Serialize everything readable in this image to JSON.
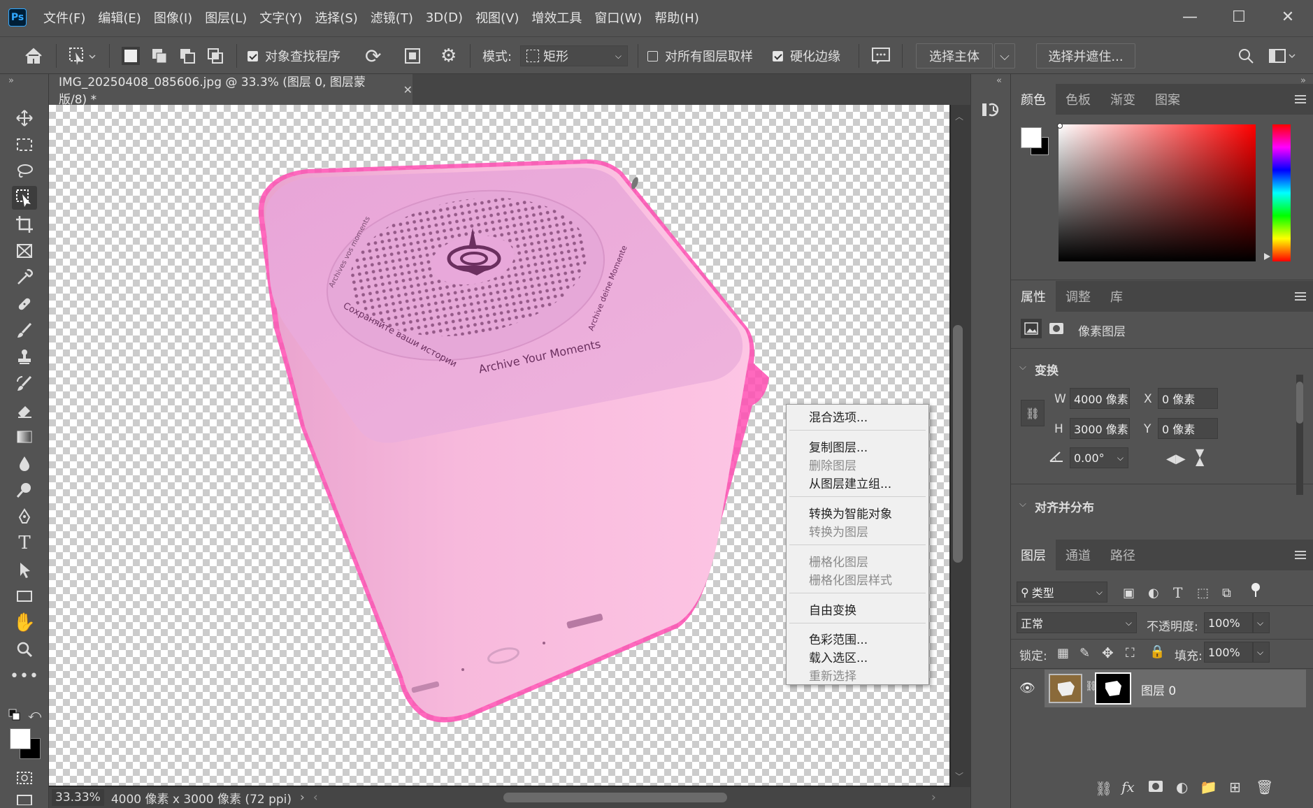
{
  "menubar": {
    "logo": "Ps",
    "items": [
      "文件(F)",
      "编辑(E)",
      "图像(I)",
      "图层(L)",
      "文字(Y)",
      "选择(S)",
      "滤镜(T)",
      "3D(D)",
      "视图(V)",
      "增效工具",
      "窗口(W)",
      "帮助(H)"
    ]
  },
  "options": {
    "object_finder": "对象查找程序",
    "mode_label": "模式:",
    "mode_value": "矩形",
    "sample_all": "对所有图层取样",
    "hard_edge": "硬化边缘",
    "select_subject": "选择主体",
    "select_mask": "选择并遮住..."
  },
  "document": {
    "tab_title": "IMG_20250408_085606.jpg @ 33.3% (图层 0, 图层蒙版/8) *",
    "zoom": "33.33%",
    "doc_info": "4000 像素 x 3000 像素 (72 ppi)",
    "speaker_text": {
      "brand_bottom": "Archive Your Moments",
      "ru": "Сохраняйте ваши истории",
      "fr_left": "Archives vos moments",
      "de_right": "Archive deine Momente"
    }
  },
  "context_menu": {
    "blending": "混合选项...",
    "duplicate": "复制图层...",
    "delete": "删除图层",
    "group": "从图层建立组...",
    "smart_object": "转换为智能对象",
    "to_layer": "转换为图层",
    "rasterize": "栅格化图层",
    "rasterize_style": "栅格化图层样式",
    "free_transform": "自由变换",
    "color_range": "色彩范围...",
    "load_selection": "载入选区...",
    "reselect": "重新选择"
  },
  "color_panel": {
    "tabs": [
      "颜色",
      "色板",
      "渐变",
      "图案"
    ],
    "hue": "#ff0000"
  },
  "properties_panel": {
    "tabs": [
      "属性",
      "调整",
      "库"
    ],
    "layer_type": "像素图层",
    "transform_title": "变换",
    "w_label": "W",
    "w_value": "4000 像素",
    "h_label": "H",
    "h_value": "3000 像素",
    "x_label": "X",
    "x_value": "0 像素",
    "y_label": "Y",
    "y_value": "0 像素",
    "angle_value": "0.00°",
    "align_title": "对齐并分布"
  },
  "layers_panel": {
    "tabs": [
      "图层",
      "通道",
      "路径"
    ],
    "filter_kind": "类型",
    "blend_mode": "正常",
    "opacity_label": "不透明度:",
    "opacity_value": "100%",
    "lock_label": "锁定:",
    "fill_label": "填充:",
    "fill_value": "100%",
    "layer_name": "图层 0"
  }
}
